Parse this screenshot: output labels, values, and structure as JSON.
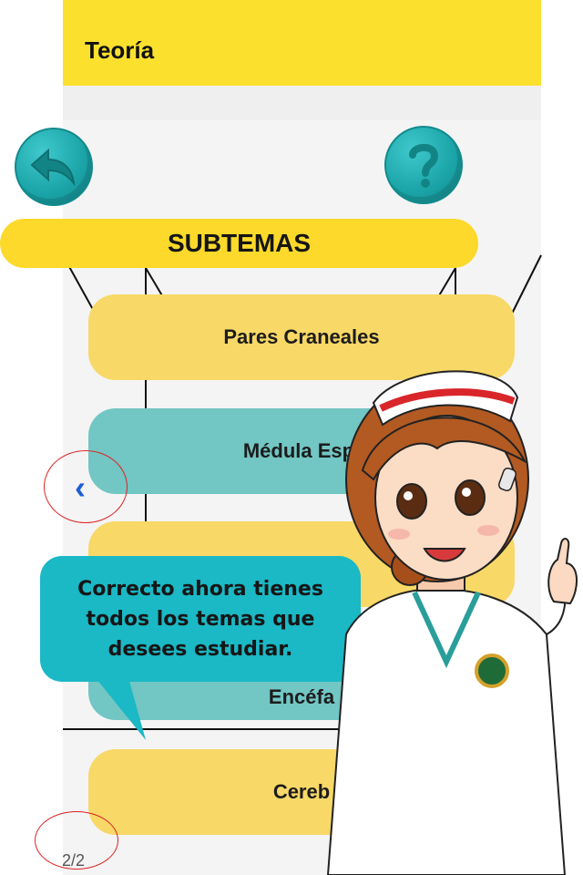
{
  "app_bar": {
    "title": "Teoría"
  },
  "header_banner": "SUBTEMAS",
  "subtopics": [
    {
      "label": "Pares Craneales",
      "color": "#f8d866"
    },
    {
      "label": "Médula Espi",
      "color": "#72c6c4"
    },
    {
      "label": "",
      "color": "#f8d866"
    },
    {
      "label": "Encéfa",
      "color": "#72c6c4"
    },
    {
      "label": "Cereb",
      "color": "#f8d866"
    }
  ],
  "nav": {
    "prev_icon": "chevron-left-icon"
  },
  "pagination": "2/2",
  "speech_bubble": "Correcto ahora tienes todos los temas que desees estudiar.",
  "colors": {
    "app_bar": "#fbe12e",
    "banner": "#fcd92a",
    "yellow_button": "#f8d866",
    "teal_button": "#72c6c4",
    "round_button": "#1aa3a6",
    "bubble": "#1bb8c5"
  }
}
